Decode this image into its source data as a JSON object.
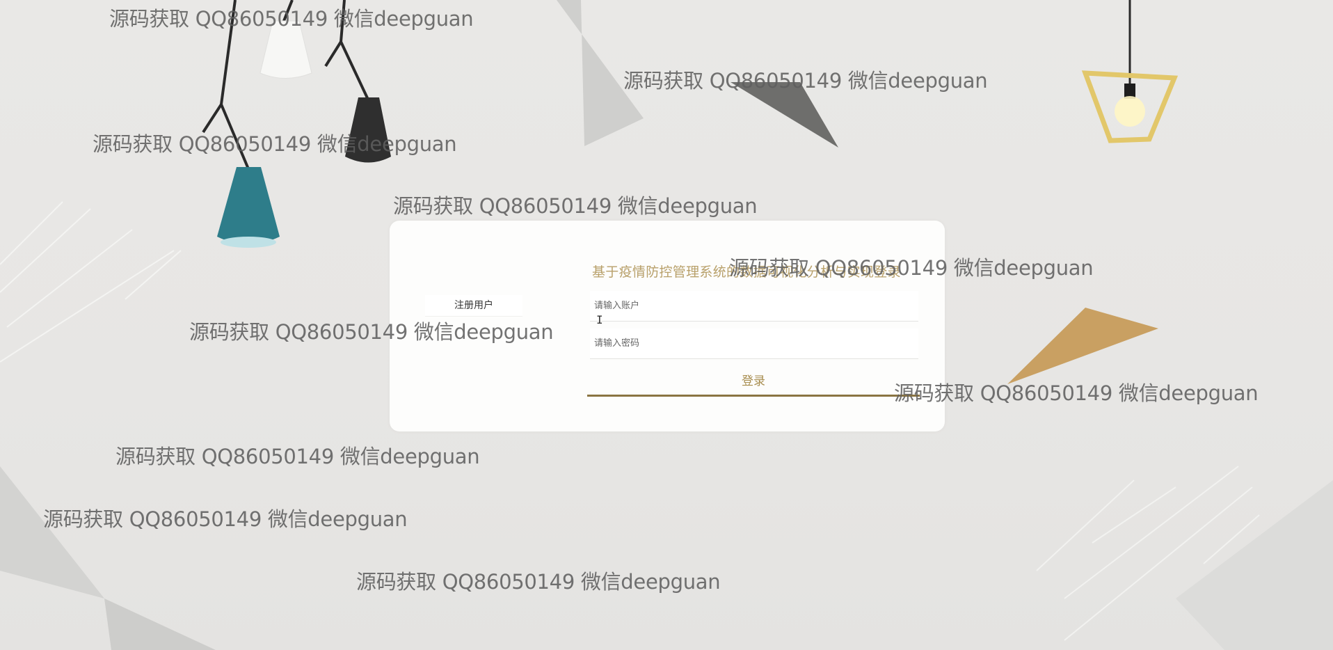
{
  "login": {
    "title": "基于疫情防控管理系统的数据可视化分析与实现登录",
    "account_placeholder": "请输入账户",
    "password_placeholder": "请输入密码",
    "login_button": "登录",
    "register_link": "注册用户"
  },
  "watermarks": [
    "源码获取 QQ86050149 微信deepguan",
    "源码获取 QQ86050149 微信deepguan",
    "源码获取 QQ86050149 微信deepguan",
    "源码获取 QQ86050149 微信deepguan",
    "源码获取 QQ86050149 微信deepguan",
    "源码获取 QQ86050149 微信deepguan",
    "源码获取 QQ86050149 微信deepguan",
    "源码获取 QQ86050149 微信deepguan",
    "源码获取 QQ86050149 微信deepguan",
    "源码获取 QQ86050149 微信deepguan"
  ],
  "colors": {
    "background": "#e8e7e5",
    "card": "#fdfdfc",
    "accent_gold": "#a88d4f",
    "title_gold": "#b8a06a",
    "button_underline": "#8a7442"
  },
  "icons": [
    "pendant-lamp-white",
    "pendant-lamp-black",
    "pendant-lamp-teal",
    "pendant-lamp-gold-frame",
    "text-cursor"
  ]
}
